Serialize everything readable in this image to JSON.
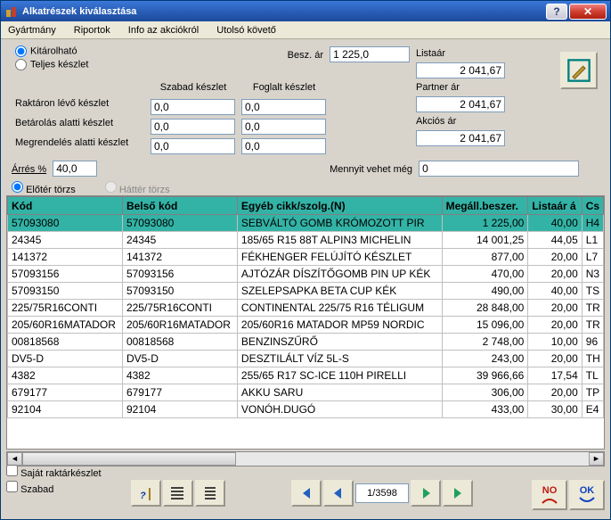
{
  "window": {
    "title": "Alkatrészek kiválasztása"
  },
  "menu": {
    "gyartmany": "Gyártmány",
    "riportok": "Riportok",
    "info": "Info az akciókról",
    "utolso": "Utolsó követő"
  },
  "radios": {
    "kitarolhato": "Kitárolható",
    "teljes": "Teljes készlet"
  },
  "besz": {
    "label": "Besz. ár",
    "value": "1 225,0"
  },
  "lista": {
    "listaar_lbl": "Listaár",
    "listaar_val": "2 041,67",
    "partner_lbl": "Partner ár",
    "partner_val": "2 041,67",
    "akcios_lbl": "Akciós ár",
    "akcios_val": "2 041,67"
  },
  "stock": {
    "hdr_szabad": "Szabad készlet",
    "hdr_foglalt": "Foglalt készlet",
    "r1_lbl": "Raktáron lévő készlet",
    "r1_sz": "0,0",
    "r1_fo": "0,0",
    "r2_lbl": "Betárolás alatti készlet",
    "r2_sz": "0,0",
    "r2_fo": "0,0",
    "r3_lbl": "Megrendelés alatti készlet",
    "r3_sz": "0,0",
    "r3_fo": "0,0"
  },
  "arres": {
    "label": "Árrés %",
    "value": "40,0"
  },
  "mennyit": {
    "label": "Mennyit vehet még",
    "value": "0"
  },
  "tabradios": {
    "eloter": "Előtér törzs",
    "hatter": "Háttér törzs"
  },
  "grid": {
    "headers": {
      "kod": "Kód",
      "belso": "Belső kód",
      "egyeb": "Egyéb cikk/szolg.(N)",
      "megall": "Megáll.beszer.",
      "lista": "Listaár á",
      "cs": "Cs"
    },
    "rows": [
      {
        "kod": "57093080",
        "belso": "57093080",
        "egyeb": "SEBVÁLTÓ GOMB KRÓMOZOTT PIR",
        "megall": "1 225,00",
        "lista": "40,00",
        "cs": "H4"
      },
      {
        "kod": "24345",
        "belso": "24345",
        "egyeb": "185/65 R15 88T ALPIN3 MICHELIN",
        "megall": "14 001,25",
        "lista": "44,05",
        "cs": "L1"
      },
      {
        "kod": "141372",
        "belso": "141372",
        "egyeb": "FÉKHENGER FELÚJÍTÓ KÉSZLET",
        "megall": "877,00",
        "lista": "20,00",
        "cs": "L7"
      },
      {
        "kod": "57093156",
        "belso": "57093156",
        "egyeb": "AJTÓZÁR DÍSZÍTŐGOMB PIN UP KÉK",
        "megall": "470,00",
        "lista": "20,00",
        "cs": "N3"
      },
      {
        "kod": "57093150",
        "belso": "57093150",
        "egyeb": "SZELEPSAPKA BETA CUP KÉK",
        "megall": "490,00",
        "lista": "40,00",
        "cs": "TS"
      },
      {
        "kod": "225/75R16CONTI",
        "belso": "225/75R16CONTI",
        "egyeb": "CONTINENTAL 225/75 R16 TÉLIGUM",
        "megall": "28 848,00",
        "lista": "20,00",
        "cs": "TR"
      },
      {
        "kod": "205/60R16MATADOR",
        "belso": "205/60R16MATADOR",
        "egyeb": "205/60R16 MATADOR MP59 NORDIC",
        "megall": "15 096,00",
        "lista": "20,00",
        "cs": "TR"
      },
      {
        "kod": "00818568",
        "belso": "00818568",
        "egyeb": "BENZINSZŰRŐ",
        "megall": "2 748,00",
        "lista": "10,00",
        "cs": "96"
      },
      {
        "kod": "DV5-D",
        "belso": "DV5-D",
        "egyeb": "DESZTILÁLT VÍZ 5L-S",
        "megall": "243,00",
        "lista": "20,00",
        "cs": "TH"
      },
      {
        "kod": "4382",
        "belso": "4382",
        "egyeb": "255/65 R17 SC-ICE 110H PIRELLI",
        "megall": "39 966,66",
        "lista": "17,54",
        "cs": "TL"
      },
      {
        "kod": "679177",
        "belso": "679177",
        "egyeb": "AKKU SARU",
        "megall": "306,00",
        "lista": "20,00",
        "cs": "TP"
      },
      {
        "kod": "92104",
        "belso": "92104",
        "egyeb": "VONÓH.DUGÓ",
        "megall": "433,00",
        "lista": "30,00",
        "cs": "E4"
      }
    ]
  },
  "bottom": {
    "sajat": "Saját raktárkészlet",
    "szabad": "Szabad",
    "page": "1/3598",
    "no": "NO",
    "ok": "OK"
  }
}
